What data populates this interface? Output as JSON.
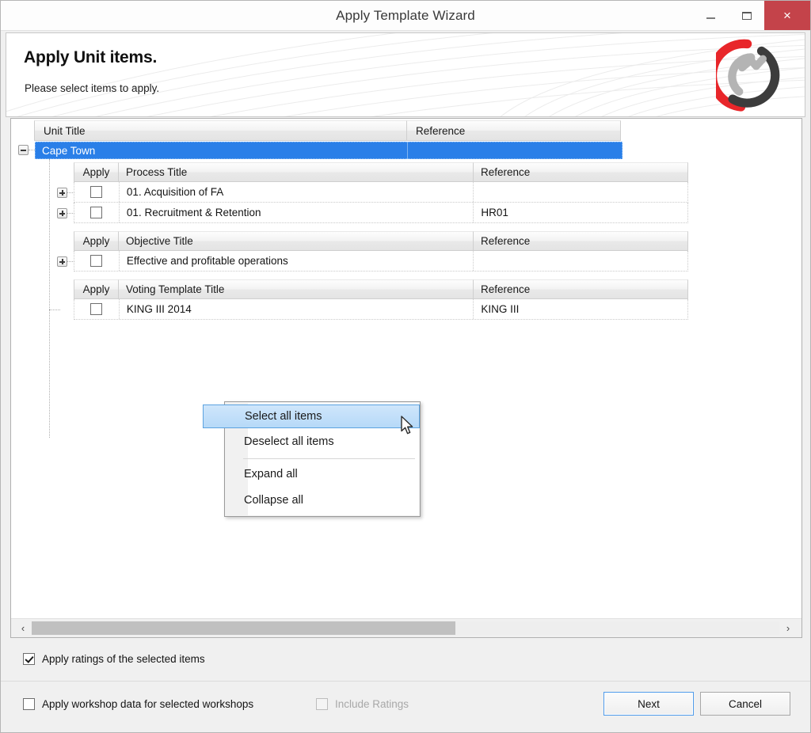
{
  "window": {
    "title": "Apply Template Wizard",
    "minimize_label": "Minimize",
    "maximize_label": "Maximize",
    "close_label": "×"
  },
  "banner": {
    "heading": "Apply Unit items.",
    "subheading": "Please select items to apply."
  },
  "tree": {
    "root_columns": [
      "Unit Title",
      "Reference"
    ],
    "root_node": {
      "label": "Cape Town",
      "reference": "",
      "expander": "minus",
      "selected": true
    },
    "groups": [
      {
        "columns": [
          "Apply",
          "Process Title",
          "Reference"
        ],
        "rows": [
          {
            "expander": "plus",
            "checked": false,
            "title": "01. Acquisition of FA",
            "reference": ""
          },
          {
            "expander": "plus",
            "checked": false,
            "title": "01. Recruitment & Retention",
            "reference": "HR01"
          }
        ]
      },
      {
        "columns": [
          "Apply",
          "Objective Title",
          "Reference"
        ],
        "rows": [
          {
            "expander": "plus",
            "checked": false,
            "title": "Effective and profitable operations",
            "reference": ""
          }
        ]
      },
      {
        "columns": [
          "Apply",
          "Voting Template Title",
          "Reference"
        ],
        "rows": [
          {
            "expander": "none",
            "checked": false,
            "title": "KING III 2014",
            "reference": "KING III"
          }
        ]
      }
    ]
  },
  "context_menu": {
    "items": [
      {
        "label": "Select all items",
        "highlighted": true
      },
      {
        "label": "Deselect all items",
        "highlighted": false
      },
      {
        "label": "Expand all",
        "highlighted": false
      },
      {
        "label": "Collapse all",
        "highlighted": false
      }
    ]
  },
  "scrollbar": {
    "left_arrow": "‹",
    "right_arrow": "›"
  },
  "footer": {
    "apply_ratings": {
      "label": "Apply ratings of the selected items",
      "checked": true
    },
    "apply_workshop": {
      "label": "Apply workshop data for selected workshops",
      "checked": false
    },
    "include_ratings": {
      "label": "Include Ratings",
      "checked": false,
      "disabled": true
    },
    "next_label": "Next",
    "cancel_label": "Cancel"
  },
  "colors": {
    "selection_blue": "#2a7fe8",
    "close_red": "#c4434a",
    "logo_red": "#e8262a",
    "logo_dark": "#3c3c3c",
    "logo_gray": "#b4b4b4",
    "focus_blue": "#4f9bea"
  }
}
